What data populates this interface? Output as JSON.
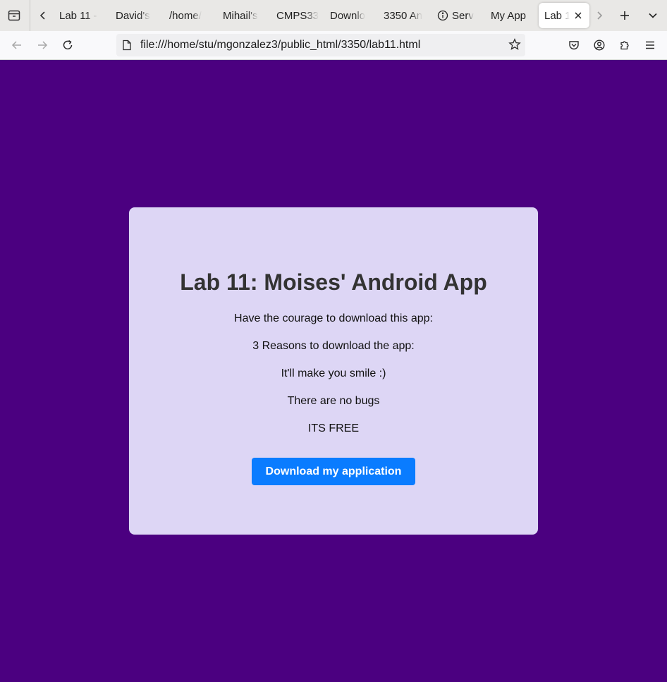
{
  "browser": {
    "tabs": [
      {
        "label": "Lab 11 -",
        "active": false
      },
      {
        "label": "David's",
        "active": false
      },
      {
        "label": "/home/",
        "active": false
      },
      {
        "label": "Mihail's",
        "active": false
      },
      {
        "label": "CMPS33",
        "active": false
      },
      {
        "label": "Downlo",
        "active": false
      },
      {
        "label": "3350 An",
        "active": false
      },
      {
        "label": "Serv",
        "active": false,
        "icon": "info-icon"
      },
      {
        "label": "My App",
        "active": false
      },
      {
        "label": "Lab 1",
        "active": true
      }
    ],
    "url": "file:///home/stu/mgonzalez3/public_html/3350/lab11.html"
  },
  "page": {
    "background_color": "#4b0080",
    "card_color": "#ddd6f5",
    "title": "Lab 11: Moises' Android App",
    "intro": "Have the courage to download this app:",
    "reasons_heading": "3 Reasons to download the app:",
    "reasons": [
      "It'll make you smile :)",
      "There are no bugs",
      "ITS FREE"
    ],
    "download_button": "Download my application",
    "button_color": "#0a7cff"
  }
}
